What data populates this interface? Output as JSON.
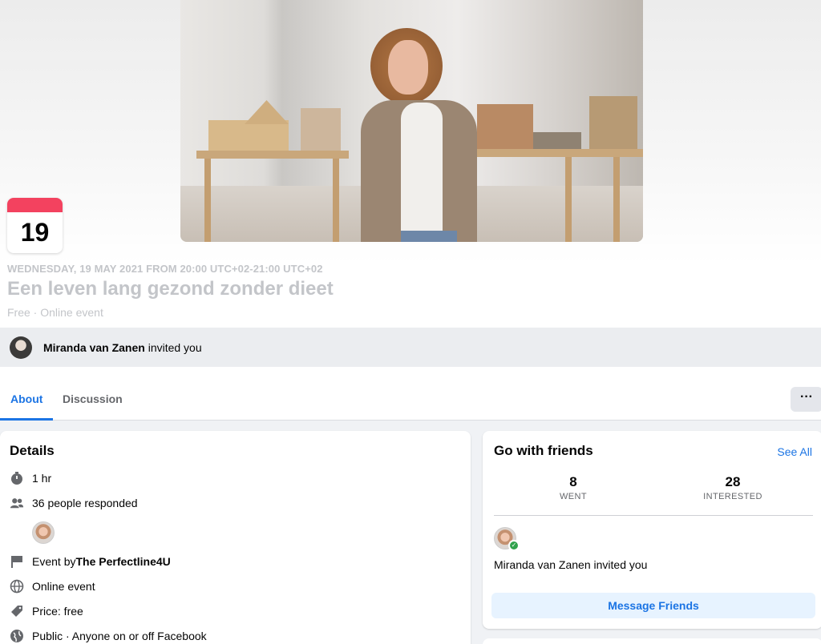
{
  "calendar": {
    "day": "19"
  },
  "event": {
    "date_line": "WEDNESDAY, 19 MAY 2021 FROM 20:00 UTC+02-21:00 UTC+02",
    "title": "Een leven lang gezond zonder dieet",
    "meta": "Free · Online event"
  },
  "invite": {
    "name": "Miranda van Zanen",
    "suffix": " invited you"
  },
  "tabs": [
    {
      "label": "About",
      "active": true
    },
    {
      "label": "Discussion",
      "active": false
    }
  ],
  "more_button": {
    "label": "···"
  },
  "details": {
    "title": "Details",
    "duration": "1 hr",
    "responded": "36 people responded",
    "event_by_prefix": "Event by ",
    "event_by_name": "The Perfectline4U",
    "location": "Online event",
    "price": "Price: free",
    "privacy": "Public · Anyone on or off Facebook"
  },
  "friends": {
    "title": "Go with friends",
    "see_all": "See All",
    "went": {
      "num": "8",
      "label": "WENT"
    },
    "interested": {
      "num": "28",
      "label": "INTERESTED"
    },
    "invite_text": "Miranda van Zanen invited you",
    "message_button": "Message Friends"
  },
  "icons": {
    "duration": "clock-icon",
    "responded": "people-icon",
    "event_by": "flag-icon",
    "location": "globe-icon",
    "price": "tag-icon",
    "privacy": "globe-icon",
    "more": "more-icon"
  },
  "colors": {
    "accent": "#1b74e4",
    "calendar_top": "#f3425f",
    "check": "#31a24c"
  }
}
